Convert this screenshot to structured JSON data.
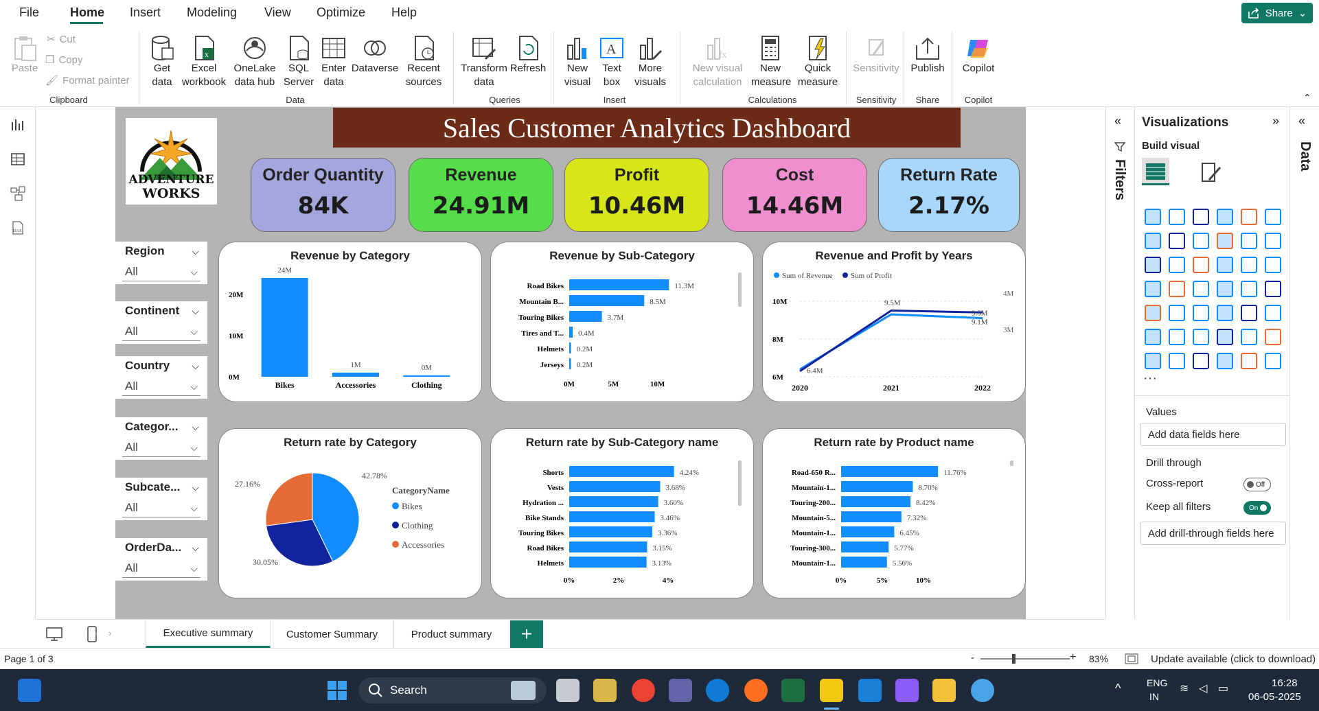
{
  "menu": {
    "items": [
      "File",
      "Home",
      "Insert",
      "Modeling",
      "View",
      "Optimize",
      "Help"
    ],
    "active": "Home",
    "share": "Share"
  },
  "ribbon": {
    "clipboard": {
      "paste": "Paste",
      "cut": "Cut",
      "copy": "Copy",
      "format_painter": "Format painter",
      "group": "Clipboard"
    },
    "data": {
      "get_data": "Get data",
      "excel": "Excel workbook",
      "onelake": "OneLake data hub",
      "sql": "SQL Server",
      "enter": "Enter data",
      "dataverse": "Dataverse",
      "recent": "Recent sources",
      "group": "Data"
    },
    "queries": {
      "transform": "Transform data",
      "refresh": "Refresh",
      "group": "Queries"
    },
    "insert": {
      "new_visual": "New visual",
      "text_box": "Text box",
      "more_visuals": "More visuals",
      "group": "Insert"
    },
    "calculations": {
      "new_visual_calc": "New visual calculation",
      "new_measure": "New measure",
      "quick_measure": "Quick measure",
      "group": "Calculations"
    },
    "sensitivity": {
      "label": "Sensitivity",
      "group": "Sensitivity"
    },
    "share": {
      "publish": "Publish",
      "group": "Share"
    },
    "copilot": {
      "label": "Copilot",
      "group": "Copilot"
    }
  },
  "report": {
    "title": "Sales Customer Analytics Dashboard",
    "logo": {
      "line1": "ADVENTURE",
      "line2": "WORKS"
    },
    "kpis": [
      {
        "label": "Order Quantity",
        "value": "84K",
        "color": "#a4a6de"
      },
      {
        "label": "Revenue",
        "value": "24.91M",
        "color": "#55de4a"
      },
      {
        "label": "Profit",
        "value": "10.46M",
        "color": "#d7e61b"
      },
      {
        "label": "Cost",
        "value": "14.46M",
        "color": "#ef8fcf"
      },
      {
        "label": "Return Rate",
        "value": "2.17%",
        "color": "#a9d7fb"
      }
    ],
    "slicers": [
      {
        "label": "Region",
        "value": "All"
      },
      {
        "label": "Continent",
        "value": "All"
      },
      {
        "label": "Country",
        "value": "All"
      },
      {
        "label": "Categor...",
        "value": "All"
      },
      {
        "label": "Subcate...",
        "value": "All"
      },
      {
        "label": "OrderDa...",
        "value": "All"
      }
    ]
  },
  "chart_data": [
    {
      "type": "bar",
      "title": "Revenue by Category",
      "categories": [
        "Bikes",
        "Accessories",
        "Clothing"
      ],
      "values": [
        24,
        1,
        0
      ],
      "data_labels": [
        "24M",
        "1M",
        "0M"
      ],
      "yticks": [
        "0M",
        "10M",
        "20M"
      ],
      "ylim": [
        0,
        25
      ],
      "color": "#118dff"
    },
    {
      "type": "bar",
      "orientation": "horizontal",
      "title": "Revenue by Sub-Category",
      "categories": [
        "Road Bikes",
        "Mountain B...",
        "Touring Bikes",
        "Tires and T...",
        "Helmets",
        "Jerseys"
      ],
      "values": [
        11.3,
        8.5,
        3.7,
        0.4,
        0.2,
        0.2
      ],
      "data_labels": [
        "11.3M",
        "8.5M",
        "3.7M",
        "0.4M",
        "0.2M",
        "0.2M"
      ],
      "xticks": [
        "0M",
        "5M",
        "10M"
      ],
      "xlim": [
        0,
        14
      ],
      "color": "#118dff"
    },
    {
      "type": "line",
      "title": "Revenue and Profit by Years",
      "x": [
        "2020",
        "2021",
        "2022"
      ],
      "series": [
        {
          "name": "Sum of Revenue",
          "values": [
            6.4,
            9.3,
            9.1
          ],
          "color": "#118dff"
        },
        {
          "name": "Sum of Profit",
          "values": [
            6.3,
            9.5,
            9.4
          ],
          "color": "#12239e"
        }
      ],
      "data_labels": [
        "6.4M",
        "9.5M",
        "9.3M",
        "9.1M"
      ],
      "left_ticks": [
        "6M",
        "8M",
        "10M"
      ],
      "right_ticks": [
        "3M",
        "4M"
      ],
      "ylim": [
        6,
        10.5
      ]
    },
    {
      "type": "pie",
      "title": "Return rate by Category",
      "legend_title": "CategoryName",
      "slices": [
        {
          "name": "Bikes",
          "value": 42.78,
          "label": "42.78%",
          "color": "#118dff"
        },
        {
          "name": "Clothing",
          "value": 30.05,
          "label": "30.05%",
          "color": "#12239e"
        },
        {
          "name": "Accessories",
          "value": 27.16,
          "label": "27.16%",
          "color": "#e66c37"
        }
      ]
    },
    {
      "type": "bar",
      "orientation": "horizontal",
      "title": "Return rate by Sub-Category name",
      "categories": [
        "Shorts",
        "Vests",
        "Hydration ...",
        "Bike Stands",
        "Touring Bikes",
        "Road Bikes",
        "Helmets"
      ],
      "values": [
        4.24,
        3.68,
        3.6,
        3.46,
        3.36,
        3.15,
        3.13
      ],
      "data_labels": [
        "4.24%",
        "3.68%",
        "3.60%",
        "3.46%",
        "3.36%",
        "3.15%",
        "3.13%"
      ],
      "xticks": [
        "0%",
        "2%",
        "4%"
      ],
      "xlim": [
        0,
        5
      ],
      "color": "#118dff"
    },
    {
      "type": "bar",
      "orientation": "horizontal",
      "title": "Return rate by Product name",
      "categories": [
        "Road-650 R...",
        "Mountain-1...",
        "Touring-200...",
        "Mountain-5...",
        "Mountain-1...",
        "Touring-300...",
        "Mountain-1..."
      ],
      "values": [
        11.76,
        8.7,
        8.42,
        7.32,
        6.45,
        5.77,
        5.56
      ],
      "data_labels": [
        "11.76%",
        "8.70%",
        "8.42%",
        "7.32%",
        "6.45%",
        "5.77%",
        "5.56%"
      ],
      "xticks": [
        "0%",
        "5%",
        "10%"
      ],
      "xlim": [
        0,
        15
      ],
      "color": "#118dff"
    }
  ],
  "viz_pane": {
    "title": "Visualizations",
    "build": "Build visual",
    "values": "Values",
    "add_data": "Add data fields here",
    "drill": "Drill through",
    "cross": "Cross-report",
    "cross_state": "Off",
    "keep": "Keep all filters",
    "keep_state": "On",
    "add_drill": "Add drill-through fields here"
  },
  "filters_label": "Filters",
  "data_label": "Data",
  "tabs": [
    "Executive summary",
    "Customer Summary",
    "Product summary"
  ],
  "status": {
    "page": "Page 1 of 3",
    "zoom": "83%",
    "update": "Update available (click to download)"
  },
  "taskbar": {
    "search": "Search",
    "lang1": "ENG",
    "lang2": "IN",
    "time": "16:28",
    "date": "06-05-2025"
  }
}
